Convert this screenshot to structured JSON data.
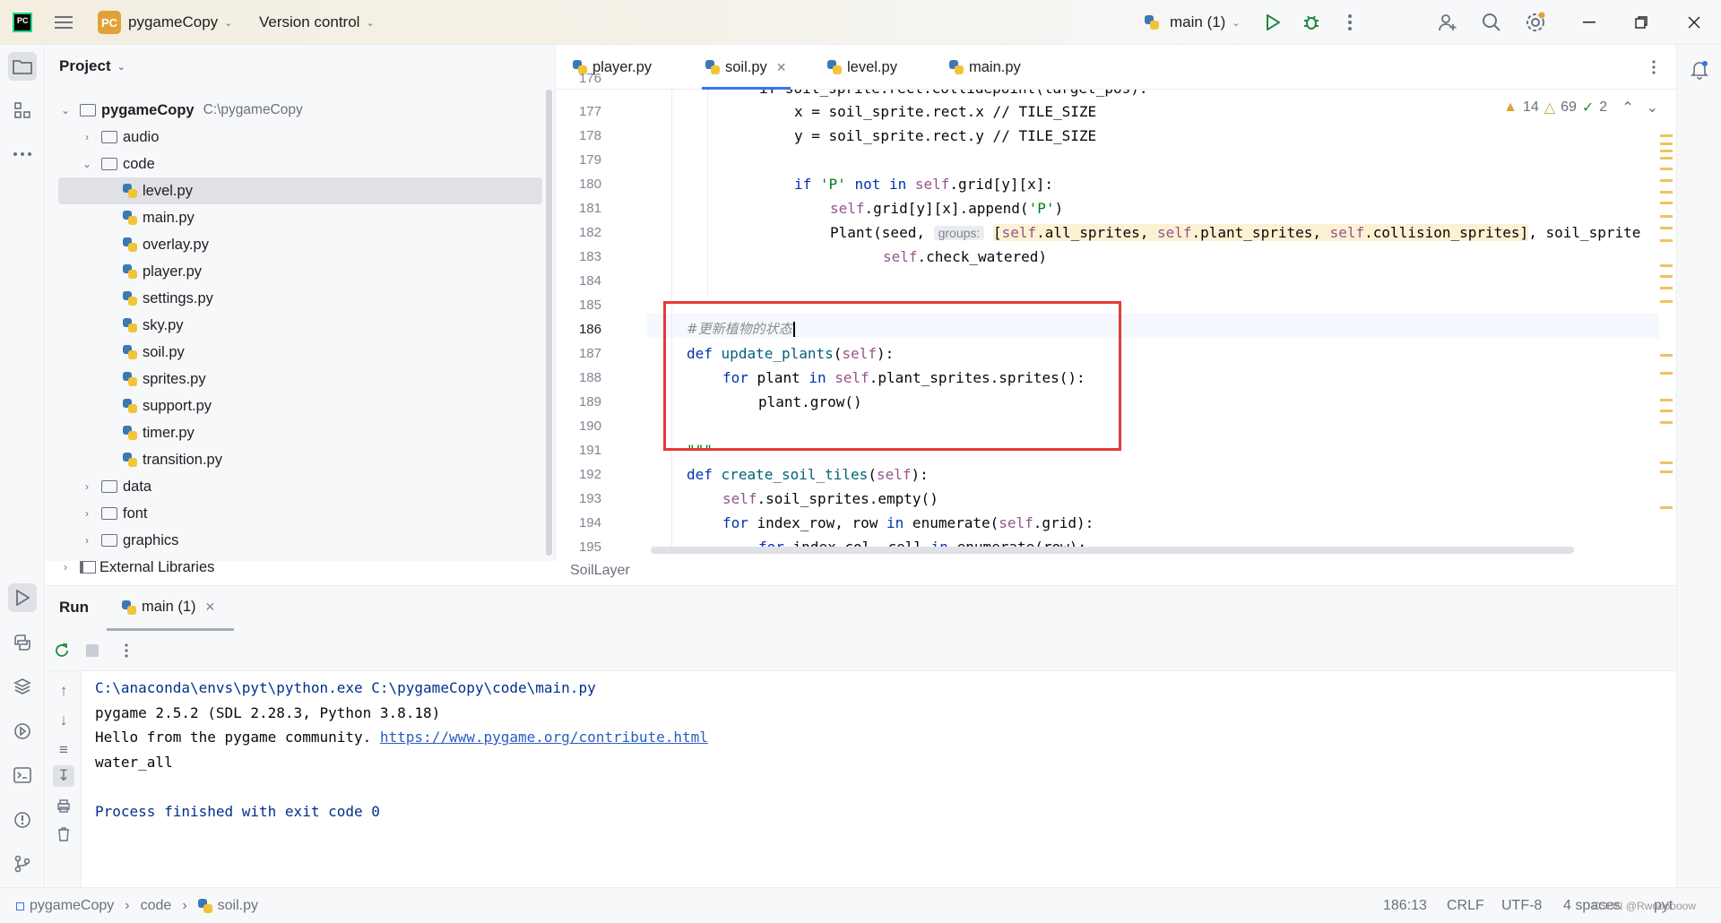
{
  "titlebar": {
    "logo": "PC",
    "project_badge": "PC",
    "project_name": "pygameCopy",
    "vcs_label": "Version control",
    "run_config": "main (1)",
    "icons": [
      "menu-icon",
      "run-icon",
      "debug-icon",
      "more-icon",
      "add-user-icon",
      "search-icon",
      "settings-icon",
      "minimize-icon",
      "restore-icon",
      "close-icon"
    ]
  },
  "project": {
    "header": "Project",
    "root_name": "pygameCopy",
    "root_path": "C:\\pygameCopy",
    "folders_top": [
      "audio",
      "code"
    ],
    "code_files": [
      "level.py",
      "main.py",
      "overlay.py",
      "player.py",
      "settings.py",
      "sky.py",
      "soil.py",
      "sprites.py",
      "support.py",
      "timer.py",
      "transition.py"
    ],
    "selected_file": "level.py",
    "folders_bottom": [
      "data",
      "font",
      "graphics"
    ],
    "external": "External Libraries"
  },
  "editor": {
    "tabs": [
      "player.py",
      "soil.py",
      "level.py",
      "main.py"
    ],
    "active_tab": "soil.py",
    "inspections": {
      "warnings": "14",
      "weak_warnings": "69",
      "ok": "2"
    },
    "line_numbers": [
      "177",
      "178",
      "179",
      "180",
      "181",
      "182",
      "183",
      "184",
      "185",
      "186",
      "187",
      "188",
      "189",
      "190",
      "191",
      "192",
      "193",
      "194",
      "195"
    ],
    "current_line": "186",
    "hint_label": "groups:",
    "comment_text": "#更新植物的状态",
    "breadcrumb": "SoilLayer"
  },
  "run": {
    "title": "Run",
    "tab": "main (1)",
    "console": {
      "line1": "C:\\anaconda\\envs\\pyt\\python.exe C:\\pygameCopy\\code\\main.py",
      "line2": "pygame 2.5.2 (SDL 2.28.3, Python 3.8.18)",
      "line3_prefix": "Hello from the pygame community. ",
      "line3_link": "https://www.pygame.org/contribute.html",
      "line4": "water_all",
      "line6": "Process finished with exit code 0"
    }
  },
  "status": {
    "crumbs": [
      "pygameCopy",
      "code",
      "soil.py"
    ],
    "position": "186:13",
    "line_sep": "CRLF",
    "encoding": "UTF-8",
    "indent": "4 spaces",
    "lang": "pyt",
    "watermark": "CSDN @Rwoooooow"
  },
  "colors": {
    "accent": "#3574f0",
    "highlight_box": "#e5393a",
    "warning": "#e0a238"
  }
}
